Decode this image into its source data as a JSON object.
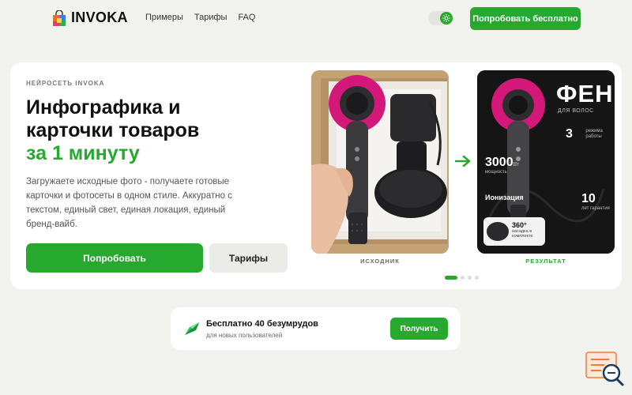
{
  "header": {
    "logo_text": "INVOKA",
    "nav": [
      "Примеры",
      "Тарифы",
      "FAQ"
    ],
    "cta_label": "Попробовать бесплатно"
  },
  "hero": {
    "eyebrow": "НЕЙРОСЕТЬ INVOKA",
    "title_line1": "Инфографика и",
    "title_line2": "карточки товаров",
    "title_accent": "за 1 минуту",
    "description": "Загружаете исходные фото - получаете готовые карточки и фотосеты в одном стиле. Аккуратно с текстом, единый свет, единая локация, единый бренд-вайб.",
    "primary_button": "Попробовать",
    "secondary_button": "Тарифы",
    "caption_source": "ИСХОДНИК",
    "caption_result": "РЕЗУЛЬТАТ",
    "carousel": {
      "total": 4,
      "active": 0
    }
  },
  "result_card": {
    "title": "ФЕН",
    "subtitle": "ДЛЯ ВОЛОС",
    "features": [
      {
        "value": "3",
        "text": "режима работы"
      },
      {
        "value": "3000",
        "unit": "Вт",
        "text": "мощность"
      },
      {
        "value": "Ионизация",
        "text": ""
      },
      {
        "value": "10",
        "unit": "лет",
        "text": "гарантия"
      },
      {
        "value": "360°",
        "text": "насадка в комплекте"
      }
    ]
  },
  "promo": {
    "title": "Бесплатно 40 безумрудов",
    "subtitle": "для новых пользователей",
    "button": "Получить"
  },
  "colors": {
    "accent": "#27a82e",
    "background": "#f2f2ef",
    "card": "#ffffff",
    "product_pink": "#d4187a"
  },
  "icons": [
    "logo-bag-icon",
    "sun-icon",
    "arrow-right-icon",
    "emerald-icon",
    "search-widget-icon"
  ]
}
